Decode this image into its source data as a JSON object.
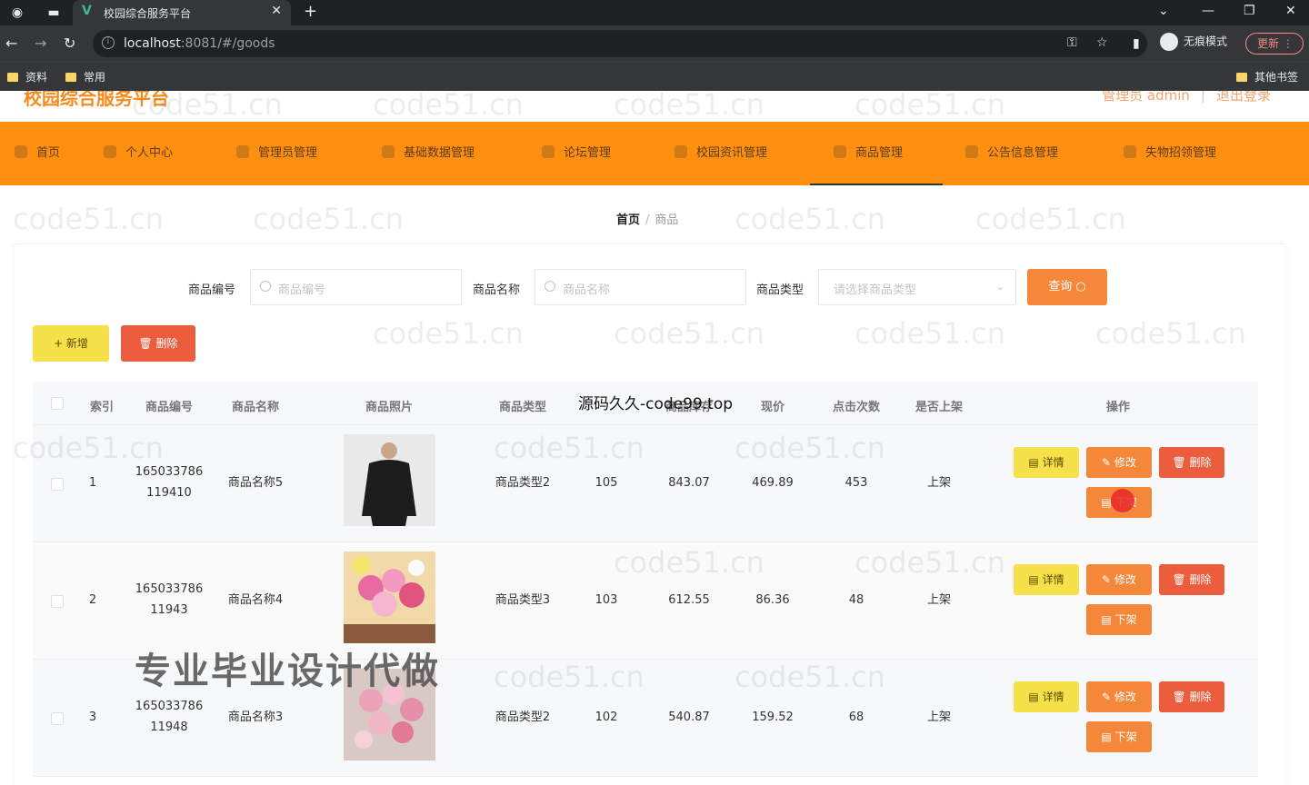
{
  "browser": {
    "tab_title": "校园综合服务平台",
    "url_host": "localhost",
    "url_rest": ":8081/#/goods",
    "incognito_label": "无痕模式",
    "update_label": "更新",
    "bookmarks": [
      "资料",
      "常用"
    ],
    "other_bookmarks": "其他书签"
  },
  "app": {
    "title": "校园综合服务平台",
    "admin_label": "管理员 admin",
    "logout_label": "退出登录"
  },
  "menu": [
    {
      "label": "首页"
    },
    {
      "label": "个人中心"
    },
    {
      "label": "管理员管理"
    },
    {
      "label": "基础数据管理"
    },
    {
      "label": "论坛管理"
    },
    {
      "label": "校园资讯管理"
    },
    {
      "label": "商品管理",
      "active": true
    },
    {
      "label": "公告信息管理"
    },
    {
      "label": "失物招领管理"
    }
  ],
  "breadcrumb": {
    "home": "首页",
    "current": "商品"
  },
  "search": {
    "code_label": "商品编号",
    "code_placeholder": "商品编号",
    "name_label": "商品名称",
    "name_placeholder": "商品名称",
    "type_label": "商品类型",
    "type_placeholder": "请选择商品类型",
    "query_label": "查询"
  },
  "actions": {
    "add_label": "+ 新增",
    "delete_label": "删除"
  },
  "table": {
    "headers": [
      "索引",
      "商品编号",
      "商品名称",
      "商品照片",
      "商品类型",
      "商品库存",
      "现价",
      "点击次数",
      "是否上架",
      "操作"
    ],
    "rows": [
      {
        "index": "1",
        "code_line1": "165033786",
        "code_line2": "119410",
        "name": "商品名称5",
        "type": "商品类型2",
        "stock": "105",
        "original": "843.07",
        "price": "469.89",
        "clicks": "453",
        "status": "上架"
      },
      {
        "index": "2",
        "code_line1": "165033786",
        "code_line2": "11943",
        "name": "商品名称4",
        "type": "商品类型3",
        "stock": "103",
        "original": "612.55",
        "price": "86.36",
        "clicks": "48",
        "status": "上架"
      },
      {
        "index": "3",
        "code_line1": "165033786",
        "code_line2": "11948",
        "name": "商品名称3",
        "type": "商品类型2",
        "stock": "102",
        "original": "540.87",
        "price": "159.52",
        "clicks": "68",
        "status": "上架"
      }
    ],
    "op_detail": "详情",
    "op_edit": "修改",
    "op_delete": "删除",
    "op_offshelf": "下架"
  },
  "overlays": {
    "watermark": "code51.cn",
    "source_text": "源码久久-code99.top",
    "promo_text": "专业毕业设计代做"
  }
}
